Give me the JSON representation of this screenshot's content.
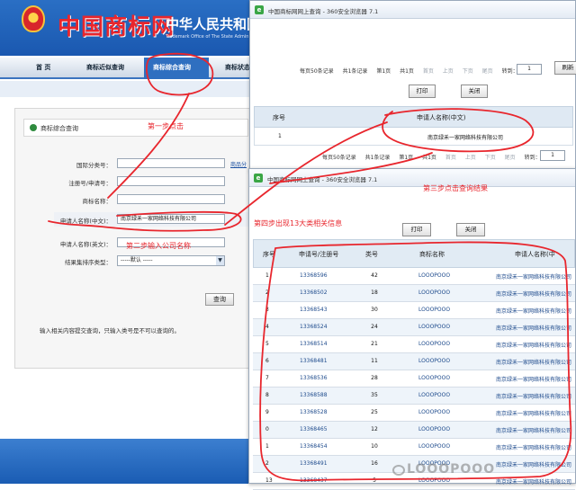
{
  "site": {
    "logo_text": "中国商标网",
    "office_cn": "中华人民共和国",
    "office_en": "Trademark Office of The State Admin",
    "nav": [
      "首 页",
      "商标近似查询",
      "商标综合查询",
      "商标状态"
    ],
    "panel_title": "商标综合查询",
    "form": {
      "intl_class_label": "国际分类号：",
      "reg_no_label": "注册号/申请号：",
      "tm_name_label": "商标名称：",
      "applicant_cn_label": "申请人名称(中文)：",
      "applicant_cn_value": "南京绿禾一家网络科技有限公司",
      "applicant_en_label": "申请人名称(英文)：",
      "sort_label": "结果集排序类型：",
      "sort_value": "-----默认 -----",
      "more_link": "商品分"
    },
    "query_button": "查询",
    "hint": "输入相关内容提交查询，只输入类号是不可以查询的。"
  },
  "win1": {
    "title": "中国商标网网上查询 - 360安全浏览器 7.1",
    "pager": {
      "per_page": "每页50条记录",
      "total": "共1条记录",
      "page_no": "第1页",
      "page_total": "共1页",
      "first": "首页",
      "prev": "上页",
      "next": "下页",
      "last": "尾页",
      "goto": "转到：",
      "page_value": "1",
      "browse_btn": "刷新"
    },
    "print_btn": "打印",
    "close_btn": "关闭",
    "col_no": "序号",
    "col_applicant": "申请人名称(中文)",
    "row_no": "1",
    "row_applicant": "南京绿禾一家网络科技有限公司"
  },
  "win2": {
    "title": "中国商标网网上查询 - 360安全浏览器 7.1",
    "print_btn": "打印",
    "close_btn": "关闭",
    "col_no": "序号",
    "col_reg": "申请号/注册号",
    "col_class": "类号",
    "col_tm": "商标名称",
    "col_applicant": "申请人名称(中",
    "rows": [
      {
        "no": "1",
        "reg": "13368596",
        "cls": "42",
        "tm": "LOOOPOOO",
        "app": "南京绿禾一家网络科技有限公司"
      },
      {
        "no": "2",
        "reg": "13368502",
        "cls": "18",
        "tm": "LOOOPOOO",
        "app": "南京绿禾一家网络科技有限公司"
      },
      {
        "no": "3",
        "reg": "13368543",
        "cls": "30",
        "tm": "LOOOPOOO",
        "app": "南京绿禾一家网络科技有限公司"
      },
      {
        "no": "4",
        "reg": "13368524",
        "cls": "24",
        "tm": "LOOOPOOO",
        "app": "南京绿禾一家网络科技有限公司"
      },
      {
        "no": "5",
        "reg": "13368514",
        "cls": "21",
        "tm": "LOOOPOOO",
        "app": "南京绿禾一家网络科技有限公司"
      },
      {
        "no": "6",
        "reg": "13368481",
        "cls": "11",
        "tm": "LOOOPOOO",
        "app": "南京绿禾一家网络科技有限公司"
      },
      {
        "no": "7",
        "reg": "13368536",
        "cls": "28",
        "tm": "LOOOPOOO",
        "app": "南京绿禾一家网络科技有限公司"
      },
      {
        "no": "8",
        "reg": "13368588",
        "cls": "35",
        "tm": "LOOOPOOO",
        "app": "南京绿禾一家网络科技有限公司"
      },
      {
        "no": "9",
        "reg": "13368528",
        "cls": "25",
        "tm": "LOOOPOOO",
        "app": "南京绿禾一家网络科技有限公司"
      },
      {
        "no": "0",
        "reg": "13368465",
        "cls": "12",
        "tm": "LOOOPOOO",
        "app": "南京绿禾一家网络科技有限公司"
      },
      {
        "no": "1",
        "reg": "13368454",
        "cls": "10",
        "tm": "LOOOPOOO",
        "app": "南京绿禾一家网络科技有限公司"
      },
      {
        "no": "2",
        "reg": "13368491",
        "cls": "16",
        "tm": "LOOOPOOO",
        "app": "南京绿禾一家网络科技有限公司"
      },
      {
        "no": "13",
        "reg": "13368437",
        "cls": "5",
        "tm": "LOOOPOOO",
        "app": "南京绿禾一家网络科技有限公司"
      }
    ]
  },
  "annotations": {
    "step1": "第一步点击",
    "step2": "第二步输入公司名称",
    "step3": "第三步点击查询结果",
    "step4": "第四步出现13大类相关信息"
  },
  "watermark": "LOOOPOOO",
  "colors": {
    "annotation": "#e8262d",
    "banner": "#2a6fc4",
    "nav_active": "#2f6fc0"
  }
}
